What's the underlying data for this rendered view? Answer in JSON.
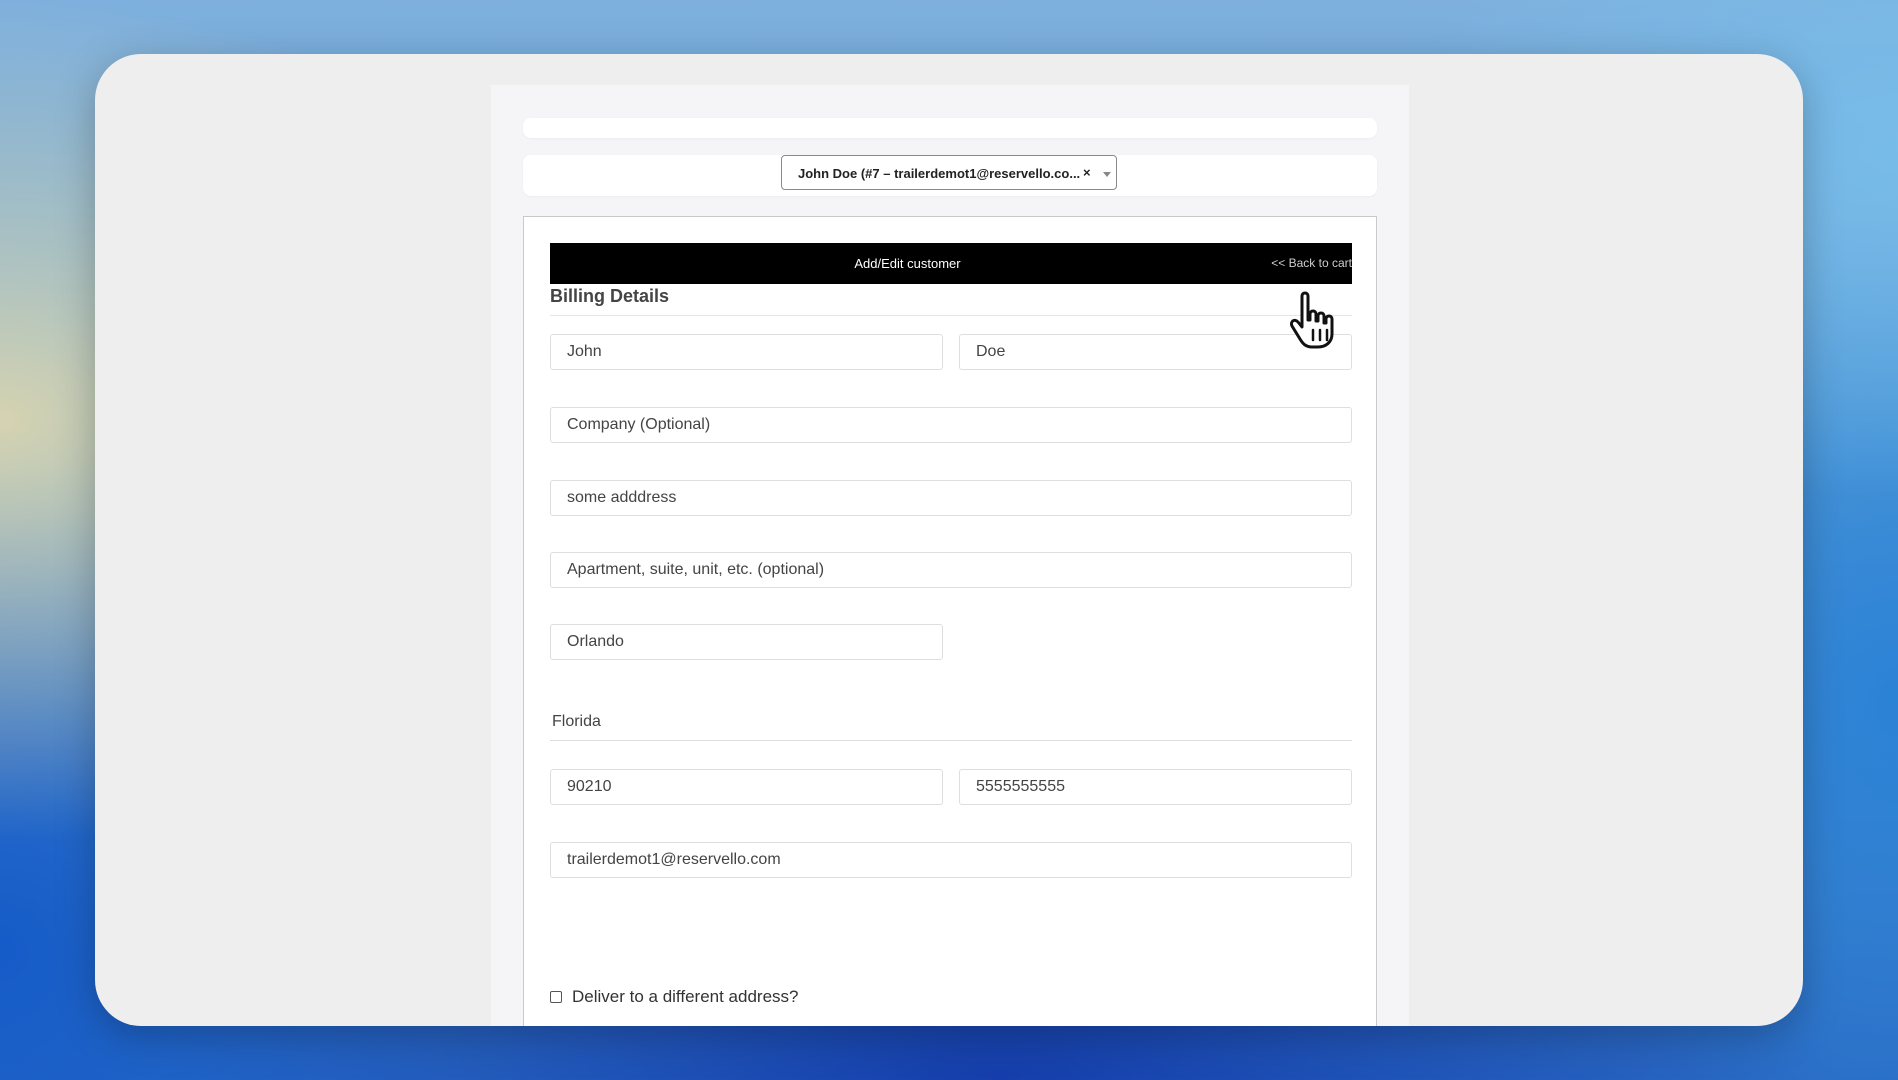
{
  "customer_selector": {
    "selected_text": "John Doe (#7 – trailerdemot1@reservello.co...",
    "clear_glyph": "×"
  },
  "header": {
    "title": "Add/Edit customer",
    "back_link": "<< Back to cart"
  },
  "billing": {
    "section_title": "Billing Details",
    "first_name": "John",
    "last_name": "Doe",
    "company_placeholder": "Company (Optional)",
    "address_1": "some adddress",
    "address_2_placeholder": "Apartment, suite, unit, etc. (optional)",
    "city": "Orlando",
    "state": "Florida",
    "postcode": "90210",
    "phone": "5555555555",
    "email": "trailerdemot1@reservello.com"
  },
  "shipping_toggle": {
    "label": "Deliver to a different address?",
    "checked": false
  },
  "colors": {
    "header_background": "#000000",
    "window_background": "#eeeeee",
    "panel_background": "#f5f5f7"
  },
  "icons": [
    "chevron-down-icon",
    "close-icon",
    "hand-pointer-cursor-icon"
  ]
}
